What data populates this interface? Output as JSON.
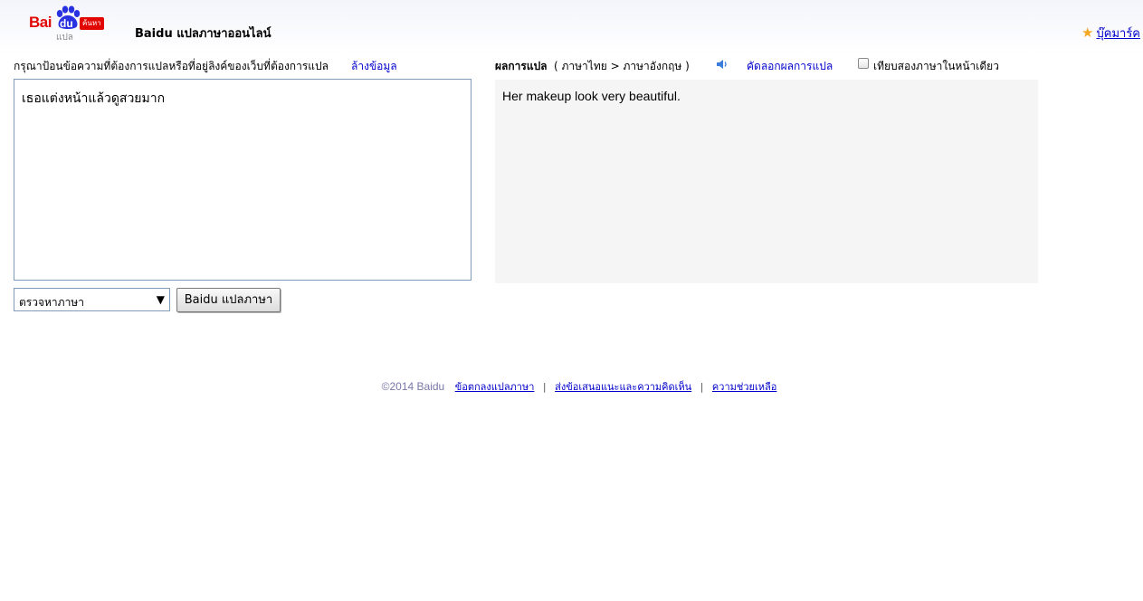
{
  "header": {
    "logo_main": "Bai",
    "logo_du": "du",
    "logo_badge": "ค้นหา",
    "logo_sub": "แปล",
    "site_title": "Baidu แปลภาษาออนไลน์",
    "bookmark_label": "บุ๊คมาร์ค"
  },
  "source": {
    "prompt": "กรุณาป้อนข้อความที่ต้องการแปลหรือที่อยู่ลิงค์ของเว็บที่ต้องการแปล",
    "clear_label": "ล้างข้อมูล",
    "text": "เธอแต่งหน้าแล้วดูสวยมาก",
    "language_select": "ตรวจหาภาษา",
    "translate_button": "Baidu แปลภาษา"
  },
  "result": {
    "label": "ผลการแปล",
    "direction": "( ภาษาไทย > ภาษาอังกฤษ )",
    "copy_label": "คัดลอกผลการแปล",
    "compare_label": "เทียบสองภาษาในหน้าเดียว",
    "compare_checked": false,
    "text": "Her makeup look very beautiful."
  },
  "footer": {
    "copyright": "©2014 Baidu",
    "terms": "ข้อตกลงแปลภาษา",
    "feedback": "ส่งข้อเสนอแนะและความคิดเห็น",
    "help": "ความช่วยเหลือ",
    "separator": "|"
  },
  "colors": {
    "brand_red": "#e10602",
    "brand_blue": "#2932e1",
    "link": "#0000cc",
    "result_bg": "#f5f5f5"
  },
  "icons": {
    "bookmark": "star-icon",
    "speak": "speaker-icon",
    "dropdown": "triangle-down-icon"
  }
}
